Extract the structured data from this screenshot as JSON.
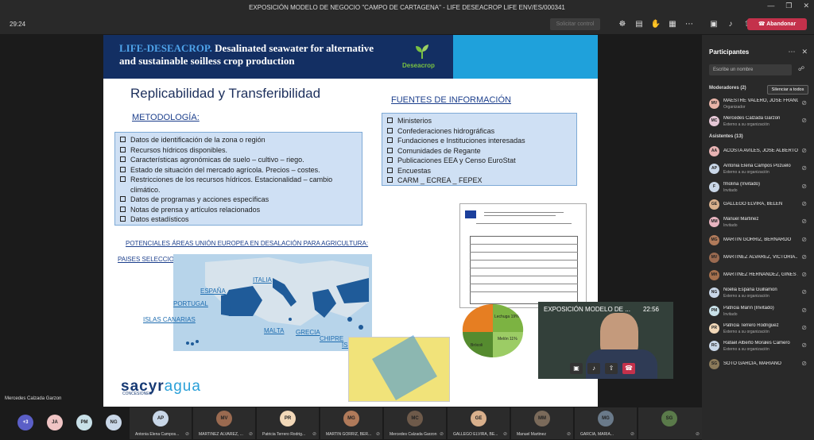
{
  "window": {
    "title": "EXPOSICIÓN MODELO DE NEGOCIO \"CAMPO DE CARTAGENA\" - LIFE DESEACROP LIFE ENV/ES/000341"
  },
  "toolbar": {
    "timer": "29:24",
    "request_control": "Solicitar control",
    "leave_label": "Abandonar"
  },
  "slide": {
    "banner_life": "LIFE-DESEACROP.",
    "banner_text": "Desalinated seawater for alternative and sustainable soilless crop production",
    "logo_name": "Deseacrop",
    "heading": "Replicabilidad y Transferibilidad",
    "metodologia_title": "METODOLOGÍA:",
    "metodologia_items": [
      "Datos de identificación de la zona o región",
      "Recursos hídricos disponibles.",
      "Características agronómicas de suelo – cultivo – riego.",
      "Estado de situación del mercado agrícola. Precios – costes.",
      "Restricciones de los recursos hídricos. Estacionalidad – cambio climático.",
      "Datos de programas y acciones específicas",
      "Notas de prensa y artículos relacionados",
      "Datos estadísticos"
    ],
    "fuentes_title": "FUENTES DE INFORMACIÓN",
    "fuentes_items": [
      "Ministerios",
      "Confederaciones hidrográficas",
      "Fundaciones e Instituciones interesadas",
      "Comunidades de Regante",
      "Publicaciones EEA y Censo EuroStat",
      "Encuestas",
      "CARM _ ECREA _ FEPEX"
    ],
    "potenciales_title": "POTENCIALES ÁREAS UNIÓN EUROPEA EN DESALACIÓN PARA AGRICULTURA:",
    "paises_title": "PAISES SELECCIONADOS:",
    "countries": [
      "ITALIA",
      "ESPAÑA",
      "PORTUGAL",
      "ISLAS CANARIAS",
      "MALTA",
      "GRECIA",
      "CHIPRE",
      "ISRAEL"
    ],
    "sponsor": "sacyr",
    "sponsor_suffix": "agua",
    "sponsor_sub": "CONCESIONES",
    "pie_labels": [
      "Lechuga 19%",
      "Melón 11%",
      "Brócoli"
    ]
  },
  "video": {
    "label": "EXPOSICIÓN MODELO DE ...",
    "time": "22:56"
  },
  "presenter_name": "Mercedes Calzada Garzon",
  "panel": {
    "title": "Participantes",
    "search_placeholder": "Escribe un nombre",
    "moderators_header": "Moderadores (2)",
    "mute_all": "Silenciar a todos",
    "attendees_header": "Asistentes (13)",
    "moderators": [
      {
        "initials": "MV",
        "name": "MAESTRE VALERO, JOSÉ FRANCI...",
        "sub": "Organizador",
        "color": "#e8b4a8"
      },
      {
        "initials": "MC",
        "name": "Mercedes Calzada Garzon",
        "sub": "Externo a su organización",
        "color": "#e5c7d6"
      }
    ],
    "attendees": [
      {
        "initials": "AA",
        "name": "ACOSTA AVILÉS, JOSÉ ALBERTO",
        "sub": "",
        "color": "#e8b4b4"
      },
      {
        "initials": "AP",
        "name": "Antonia Elena Campos Pozuelo",
        "sub": "Externo a su organización",
        "color": "#c9d7e8"
      },
      {
        "initials": "F",
        "name": "fmolina (Invitado)",
        "sub": "Invitado",
        "color": "#c9d7e8"
      },
      {
        "initials": "GE",
        "name": "GALLEGO ELVIRA, BELÉN",
        "sub": "",
        "color": "#d9b08c"
      },
      {
        "initials": "MM",
        "name": "Manuel Martinez",
        "sub": "Invitado",
        "color": "#e8b4c0"
      },
      {
        "initials": "MG",
        "name": "MARTÍN GÓRRIZ, BERNARDO",
        "sub": "",
        "color": "#b07a5a"
      },
      {
        "initials": "MV",
        "name": "MARTÍNEZ ÁLVAREZ, VICTORIA...",
        "sub": "",
        "color": "#9a6a50"
      },
      {
        "initials": "MH",
        "name": "MARTÍNEZ HERNÁNDEZ, GINÉS ...",
        "sub": "",
        "color": "#a5704d"
      },
      {
        "initials": "NG",
        "name": "Noelia España Guillamon",
        "sub": "Externo a su organización",
        "color": "#c9d7e8"
      },
      {
        "initials": "PM",
        "name": "Patricia Marín (Invitado)",
        "sub": "Invitado",
        "color": "#c8e0e8"
      },
      {
        "initials": "PR",
        "name": "Patricia Terrero Rodriguez",
        "sub": "Externo a su organización",
        "color": "#f2d8b8"
      },
      {
        "initials": "RC",
        "name": "Rafael Alberto Morales Camero",
        "sub": "Externo a su organización",
        "color": "#c9d7e8"
      },
      {
        "initials": "SG",
        "name": "SOTO GARCÍA, MARIANO",
        "sub": "",
        "color": "#8b7a5a"
      }
    ]
  },
  "strip": {
    "badges": [
      {
        "text": "+3",
        "color": "#5b5fc7"
      },
      {
        "text": "JA",
        "color": "#f0c4c4"
      },
      {
        "text": "PM",
        "color": "#c8e0e8"
      },
      {
        "text": "NG",
        "color": "#c9d7e8"
      }
    ],
    "tiles": [
      {
        "initials": "AP",
        "name": "Antonia Elena Campos...",
        "color": "#c9d7e8"
      },
      {
        "initials": "MV",
        "name": "MARTÍNEZ ÁLVAREZ, ...",
        "color": "#9a6a50"
      },
      {
        "initials": "PR",
        "name": "Patricia Terrero Rodrig...",
        "color": "#f2d8b8"
      },
      {
        "initials": "MG",
        "name": "MARTÍN GÓRRIZ, BER...",
        "color": "#b07a5a"
      },
      {
        "initials": "MC",
        "name": "Mercedes Calzada Garzon",
        "color": "#6e5a4a"
      },
      {
        "initials": "GE",
        "name": "GALLEGO ELVIRA, BE...",
        "color": "#d9b08c"
      },
      {
        "initials": "MM",
        "name": "Manuel Martinez",
        "color": "#7a6a5a"
      },
      {
        "initials": "MG",
        "name": "GARCÍA, MARIA...",
        "color": "#6a7a8a"
      },
      {
        "initials": "SG",
        "name": "",
        "color": "#5a7a4a"
      }
    ]
  }
}
